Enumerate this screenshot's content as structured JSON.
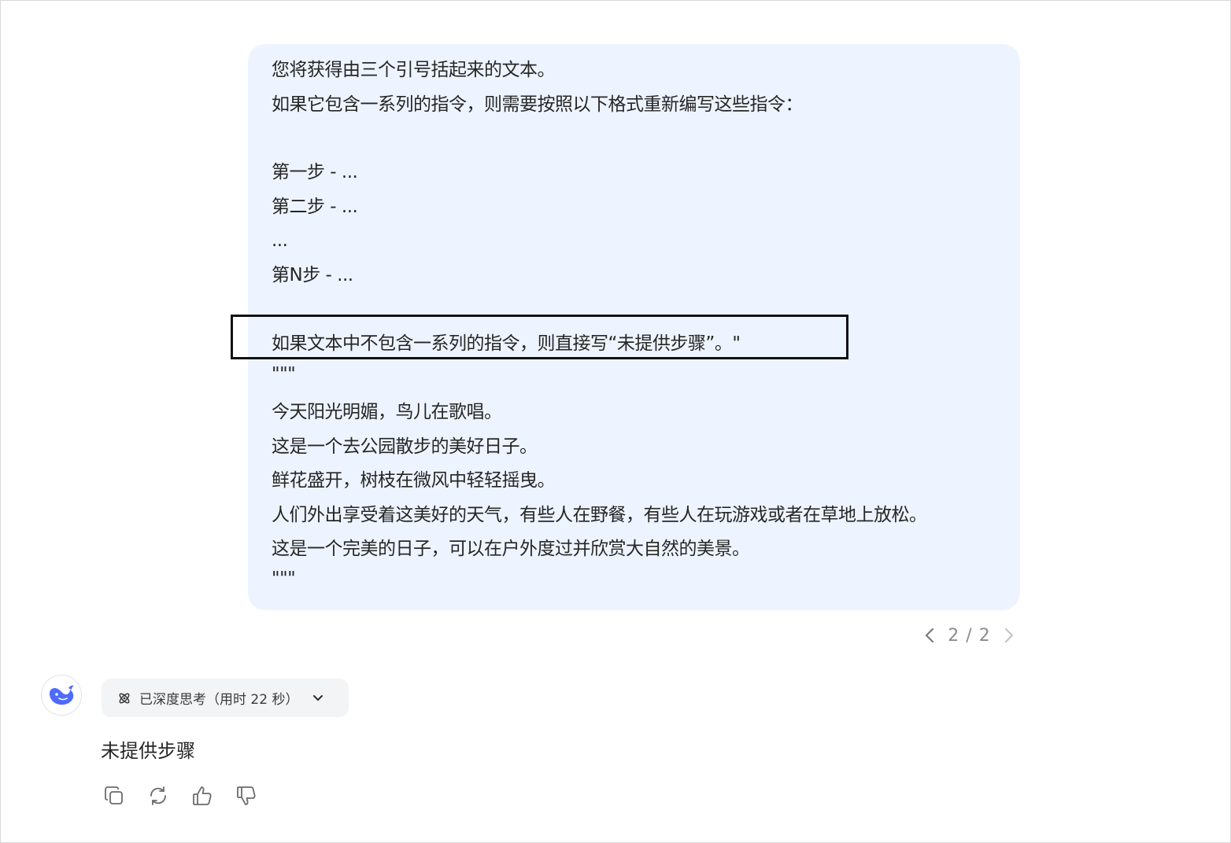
{
  "user_message": {
    "lines": [
      "您将获得由三个引号括起来的文本。",
      "如果它包含一系列的指令，则需要按照以下格式重新编写这些指令：",
      "",
      "第一步 - ...",
      "第二步 - ...",
      "...",
      "第N步 - ...",
      "",
      "如果文本中不包含一系列的指令，则直接写“未提供步骤”。\"",
      "\"\"\"",
      "今天阳光明媚，鸟儿在歌唱。",
      "这是一个去公园散步的美好日子。",
      "鲜花盛开，树枝在微风中轻轻摇曳。",
      "人们外出享受着这美好的天气，有些人在野餐，有些人在玩游戏或者在草地上放松。",
      "这是一个完美的日子，可以在户外度过并欣赏大自然的美景。",
      "\"\"\""
    ]
  },
  "pager": {
    "label": "2 / 2",
    "prev_icon": "chevron-left-icon",
    "next_icon": "chevron-right-icon"
  },
  "assistant": {
    "avatar_icon": "whale-logo-icon",
    "thinking_label": "已深度思考（用时 22 秒）",
    "thinking_icon": "atom-icon",
    "answer": "未提供步骤",
    "actions": [
      {
        "icon": "copy-icon"
      },
      {
        "icon": "regenerate-icon"
      },
      {
        "icon": "thumbs-up-icon"
      },
      {
        "icon": "thumbs-down-icon"
      }
    ]
  },
  "colors": {
    "bubble_bg": "#eef4ff",
    "accent": "#4d6bfe",
    "text": "#262626",
    "muted": "#8c8c8c"
  }
}
